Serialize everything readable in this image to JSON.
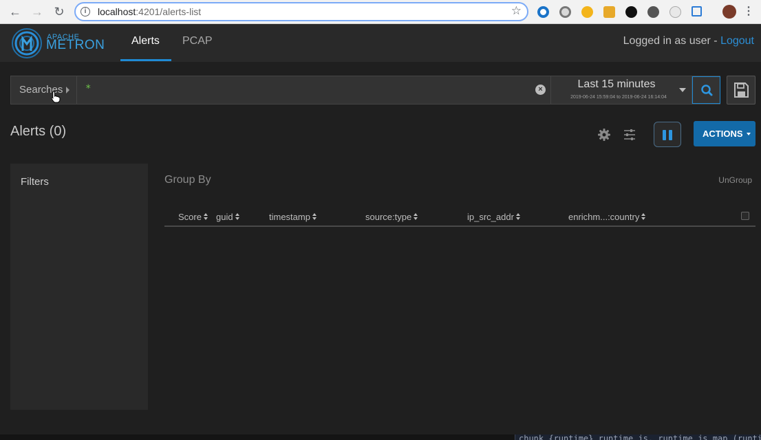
{
  "browser": {
    "url_host": "localhost",
    "url_rest": ":4201/alerts-list"
  },
  "app": {
    "logo_top": "APACHE",
    "logo_bottom": "METRON",
    "tabs": [
      {
        "label": "Alerts",
        "active": true
      },
      {
        "label": "PCAP",
        "active": false
      }
    ],
    "login_text": "Logged in as user - ",
    "logout_label": "Logout"
  },
  "search": {
    "saved_label": "Searches",
    "query": "*",
    "time_range_label": "Last 15 minutes",
    "time_from": "2019-06-24 15:59:04",
    "time_to_word": "to",
    "time_to": "2019-06-24 16:14:04"
  },
  "toolbar": {
    "title": "Alerts (0)",
    "actions_label": "ACTIONS"
  },
  "filters": {
    "title": "Filters"
  },
  "table": {
    "group_by_label": "Group By",
    "ungroup_label": "UnGroup",
    "columns": [
      "Score",
      "guid",
      "timestamp",
      "source:type",
      "ip_src_addr",
      "enrichm...:country"
    ]
  },
  "terminal": {
    "text": "chunk {runtime} runtime.js, runtime.js.map (runtime)"
  },
  "colors": {
    "accent": "#1f8ad4",
    "actions_bg": "#136aa8",
    "query_green": "#6fc24b",
    "logout_link": "#2c8fd6"
  }
}
